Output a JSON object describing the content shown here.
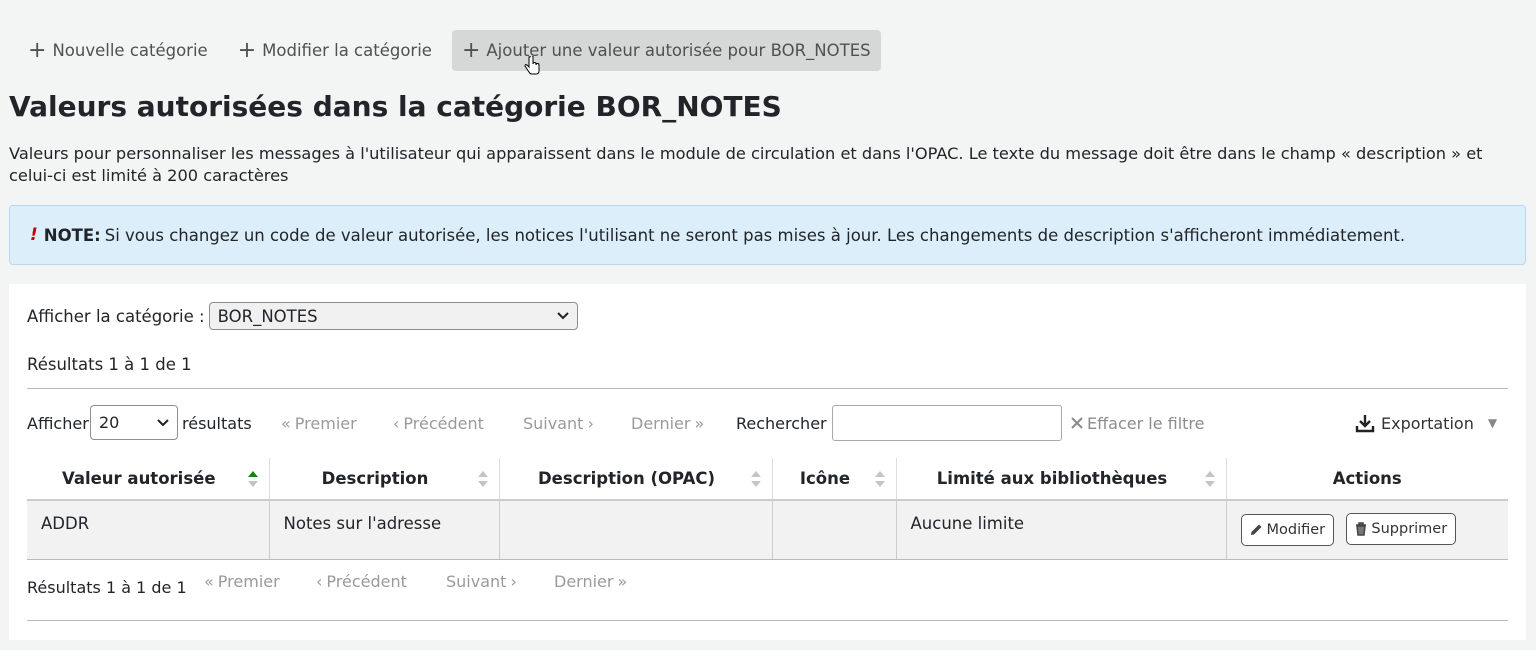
{
  "toolbar": {
    "new_category": "Nouvelle catégorie",
    "edit_category": "Modifier la catégorie",
    "add_value": "Ajouter une valeur autorisée pour BOR_NOTES"
  },
  "page_title": "Valeurs autorisées dans la catégorie BOR_NOTES",
  "intro": "Valeurs pour personnaliser les messages à l'utilisateur qui apparaissent dans le module de circulation et dans l'OPAC. Le texte du message doit être dans le champ « description » et celui-ci est limité à 200 caractères",
  "note": {
    "icon": "!",
    "label": "NOTE:",
    "text": "Si vous changez un code de valeur autorisée, les notices l'utilisant ne seront pas mises à jour. Les changements de description s'afficheront immédiatement."
  },
  "category_filter": {
    "label": "Afficher la catégorie :",
    "value": "BOR_NOTES"
  },
  "results_summary": "Résultats 1 à 1 de 1",
  "controls": {
    "show_label": "Afficher",
    "page_size": "20",
    "results_label": "résultats",
    "first": "Premier",
    "previous": "Précédent",
    "next": "Suivant",
    "last": "Dernier",
    "search_label": "Rechercher :",
    "search_value": "",
    "clear_filter": "Effacer le filtre",
    "export": "Exportation"
  },
  "table": {
    "headers": [
      "Valeur autorisée",
      "Description",
      "Description (OPAC)",
      "Icône",
      "Limité aux bibliothèques",
      "Actions"
    ],
    "rows": [
      {
        "value": "ADDR",
        "description": "Notes sur l'adresse",
        "opac_description": "",
        "icon": "",
        "libraries": "Aucune limite"
      }
    ],
    "edit_label": "Modifier",
    "delete_label": "Supprimer"
  },
  "colors": {
    "note_bg": "#ddeefb",
    "sort_active": "#1a7f1a",
    "sort_inactive": "#c4c4c4"
  }
}
